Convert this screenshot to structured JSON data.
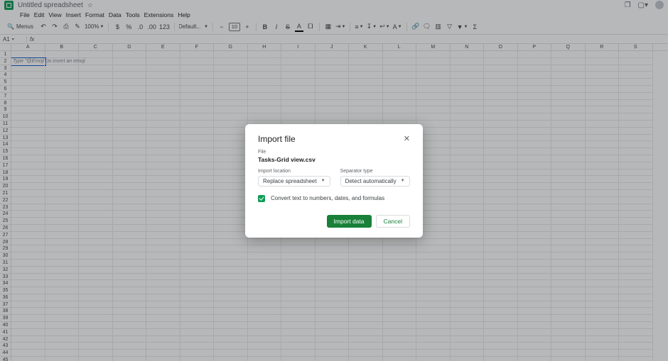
{
  "titlebar": {
    "doc_title": "Untitled spreadsheet",
    "star": "☆"
  },
  "menubar": {
    "items": [
      "File",
      "Edit",
      "View",
      "Insert",
      "Format",
      "Data",
      "Tools",
      "Extensions",
      "Help"
    ]
  },
  "toolbar": {
    "search_label": "Menus",
    "zoom": "100%",
    "font_name": "Default...",
    "font_size": "10"
  },
  "fxbar": {
    "namebox": "A1",
    "namebox_caret": "▾",
    "fx": "fx"
  },
  "grid": {
    "columns": [
      "A",
      "B",
      "C",
      "D",
      "E",
      "F",
      "G",
      "H",
      "I",
      "J",
      "K",
      "L",
      "M",
      "N",
      "O",
      "P",
      "Q",
      "R",
      "S"
    ],
    "row_count": 45,
    "placeholder": "Type \"@Emoji\" to insert an emoji"
  },
  "modal": {
    "title": "Import file",
    "file_label": "File",
    "file_name": "Tasks-Grid view.csv",
    "import_location_label": "Import location",
    "import_location_value": "Replace spreadsheet",
    "separator_label": "Separator type",
    "separator_value": "Detect automatically",
    "convert_label": "Convert text to numbers, dates, and formulas",
    "import_btn": "Import data",
    "cancel_btn": "Cancel"
  }
}
